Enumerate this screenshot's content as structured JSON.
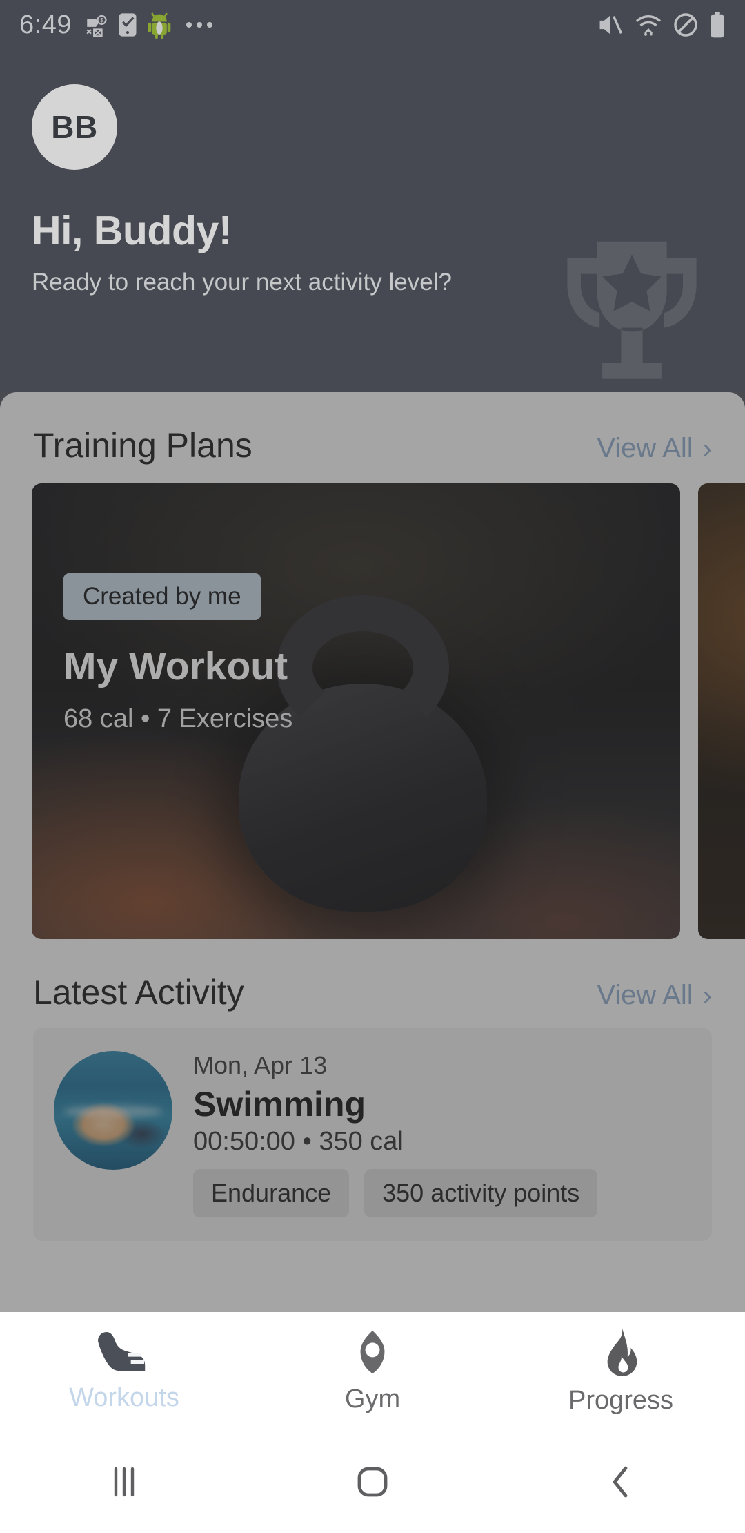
{
  "statusbar": {
    "time": "6:49",
    "left_icons": [
      "money-off-icon",
      "checkbox-phone-icon",
      "android-robot-icon",
      "more-dots-icon"
    ],
    "right_icons": [
      "mute-icon",
      "wifi-icon",
      "do-not-disturb-icon",
      "battery-full-icon"
    ]
  },
  "header": {
    "avatar_initials": "BB",
    "greeting": "Hi, Buddy!",
    "subgreeting": "Ready to reach your next activity level?",
    "watermark_icon": "trophy-icon",
    "background_color": "#51555f"
  },
  "training_plans": {
    "title": "Training Plans",
    "view_all": "View All",
    "chevron": "›",
    "cards": [
      {
        "badge": "Created by me",
        "title": "My Workout",
        "meta": "68 cal • 7 Exercises",
        "image": "kettlebell-photo"
      },
      {
        "badge": "",
        "title": "",
        "meta": "",
        "image": "gym-photo"
      }
    ]
  },
  "latest_activity": {
    "title": "Latest Activity",
    "view_all": "View All",
    "chevron": "›",
    "items": [
      {
        "date": "Mon, Apr 13",
        "name": "Swimming",
        "meta": "00:50:00 • 350 cal",
        "thumbnail": "swimming-photo",
        "chips": [
          "Endurance",
          "350 activity points"
        ]
      }
    ]
  },
  "bottom_nav": {
    "active_index": 0,
    "active_color": "#c4d6ea",
    "inactive_color": "#6a6a6c",
    "items": [
      {
        "label": "Workouts",
        "icon": "shoe-icon"
      },
      {
        "label": "Gym",
        "icon": "location-pin-icon"
      },
      {
        "label": "Progress",
        "icon": "flame-icon"
      }
    ]
  },
  "system_nav": {
    "items": [
      {
        "icon": "recents-icon"
      },
      {
        "icon": "home-icon"
      },
      {
        "icon": "back-icon"
      }
    ]
  }
}
